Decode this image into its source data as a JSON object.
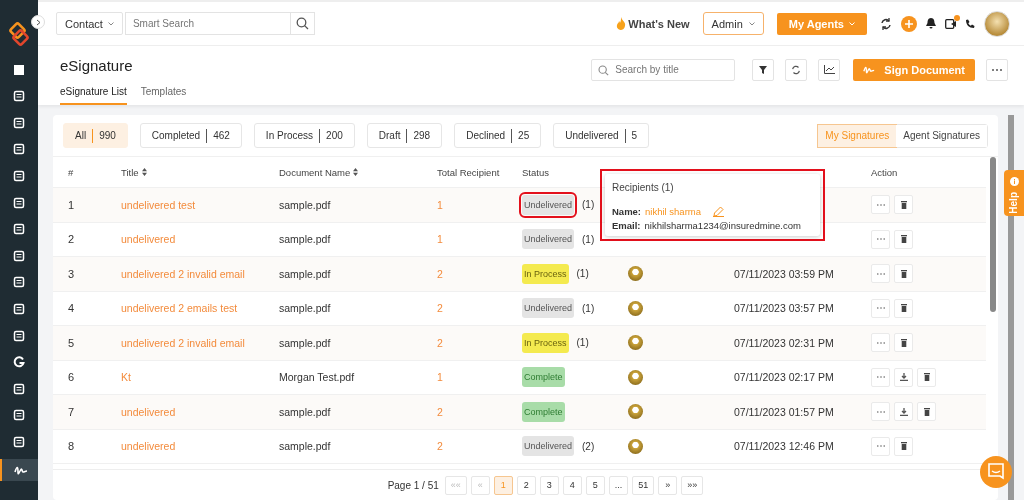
{
  "topbar": {
    "search_scope": "Contact",
    "search": {
      "placeholder": "Smart Search"
    },
    "whats_new": "What's New",
    "role": "Admin",
    "agents_button": "My Agents",
    "notification_dot": true
  },
  "page": {
    "title": "eSignature",
    "tabs": [
      {
        "label": "eSignature List",
        "selected": true
      },
      {
        "label": "Templates",
        "selected": false
      }
    ],
    "search": {
      "placeholder": "Search by title"
    },
    "sign_button": "Sign Document"
  },
  "filters": [
    {
      "label": "All",
      "count": "990",
      "selected": true
    },
    {
      "label": "Completed",
      "count": "462",
      "selected": false
    },
    {
      "label": "In Process",
      "count": "200",
      "selected": false
    },
    {
      "label": "Draft",
      "count": "298",
      "selected": false
    },
    {
      "label": "Declined",
      "count": "25",
      "selected": false
    },
    {
      "label": "Undelivered",
      "count": "5",
      "selected": false
    }
  ],
  "scope_tabs": [
    {
      "label": "My Signatures",
      "selected": true
    },
    {
      "label": "Agent Signatures",
      "selected": false
    }
  ],
  "table": {
    "columns": [
      {
        "label": "#",
        "sortable": false
      },
      {
        "label": "Title",
        "sortable": true
      },
      {
        "label": "Document Name",
        "sortable": true
      },
      {
        "label": "Total Recipient",
        "sortable": false
      },
      {
        "label": "Status",
        "sortable": false
      },
      {
        "label": "Action",
        "sortable": false
      }
    ],
    "rows": [
      {
        "num": "1",
        "title": "undelivered test",
        "document": "sample.pdf",
        "recipients": "1",
        "status": {
          "kind": "undelivered",
          "label": "Undelivered",
          "highlighted": true
        },
        "count": "(1)",
        "avatar": false,
        "download": false
      },
      {
        "num": "2",
        "title": "undelivered",
        "document": "sample.pdf",
        "recipients": "1",
        "status": {
          "kind": "undelivered",
          "label": "Undelivered",
          "highlighted": false
        },
        "count": "(1)",
        "avatar": false,
        "download": false
      },
      {
        "num": "3",
        "title": "undelivered 2 invalid email",
        "document": "sample.pdf",
        "recipients": "2",
        "status": {
          "kind": "in_process",
          "label": "In Process",
          "highlighted": false
        },
        "count": "(1)",
        "avatar": true,
        "created": "07/11/2023 03:59 PM",
        "download": false
      },
      {
        "num": "4",
        "title": "undelivered 2 emails test",
        "document": "sample.pdf",
        "recipients": "2",
        "status": {
          "kind": "undelivered",
          "label": "Undelivered",
          "highlighted": false
        },
        "count": "(1)",
        "avatar": true,
        "created": "07/11/2023 03:57 PM",
        "download": false
      },
      {
        "num": "5",
        "title": "undelivered 2 invalid email",
        "document": "sample.pdf",
        "recipients": "2",
        "status": {
          "kind": "in_process",
          "label": "In Process",
          "highlighted": false
        },
        "count": "(1)",
        "avatar": true,
        "created": "07/11/2023 02:31 PM",
        "download": false
      },
      {
        "num": "6",
        "title": "Kt",
        "document": "Morgan Test.pdf",
        "recipients": "1",
        "status": {
          "kind": "complete",
          "label": "Complete",
          "highlighted": false
        },
        "avatar": true,
        "created": "07/11/2023 02:17 PM",
        "download": true
      },
      {
        "num": "7",
        "title": "undelivered",
        "document": "sample.pdf",
        "recipients": "2",
        "status": {
          "kind": "complete",
          "label": "Complete",
          "highlighted": false
        },
        "avatar": true,
        "created": "07/11/2023 01:57 PM",
        "download": true
      },
      {
        "num": "8",
        "title": "undelivered",
        "document": "sample.pdf",
        "recipients": "2",
        "status": {
          "kind": "undelivered",
          "label": "Undelivered",
          "highlighted": false
        },
        "count": "(2)",
        "avatar": true,
        "created": "07/11/2023 12:46 PM",
        "download": false
      }
    ]
  },
  "popup": {
    "title": "Recipients (1)",
    "name_label": "Name:",
    "name": "nikhil sharma",
    "email_label": "Email:",
    "email": "nikhilsharma1234@insuredmine.com",
    "highlighted": true
  },
  "pagination": {
    "label": "Page 1 / 51",
    "pages": [
      {
        "label": "1",
        "selected": true
      },
      {
        "label": "2",
        "selected": false
      },
      {
        "label": "3",
        "selected": false
      },
      {
        "label": "4",
        "selected": false
      },
      {
        "label": "5",
        "selected": false
      },
      {
        "label": "...",
        "selected": false
      },
      {
        "label": "51",
        "selected": false
      }
    ],
    "first": "««",
    "prev": "«",
    "next": "»",
    "last": "»»"
  },
  "help": "Help"
}
